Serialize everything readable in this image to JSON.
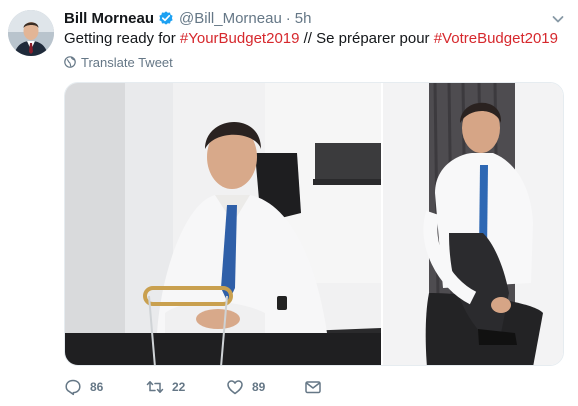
{
  "author": {
    "display_name": "Bill Morneau",
    "handle": "@Bill_Morneau",
    "separator": "·",
    "time": "5h",
    "verified": true
  },
  "tweet": {
    "text_part1": "Getting ready for ",
    "hashtag1": "#YourBudget2019",
    "text_part2": " // Se préparer pour ",
    "hashtag2": "#VotreBudget2019"
  },
  "translate_label": "Translate Tweet",
  "media": {
    "count": 2,
    "photos": [
      "photo-desk",
      "photo-chair"
    ]
  },
  "actions": {
    "replies": "86",
    "retweets": "22",
    "likes": "89"
  },
  "icons": {
    "verified": "verified-badge-icon",
    "caret": "chevron-down-icon",
    "globe": "globe-icon",
    "reply": "reply-icon",
    "retweet": "retweet-icon",
    "like": "heart-icon",
    "dm": "envelope-icon"
  },
  "colors": {
    "hashtag": "#d6282d",
    "verified": "#1da1f2",
    "muted": "#657786",
    "text": "#14171a"
  }
}
